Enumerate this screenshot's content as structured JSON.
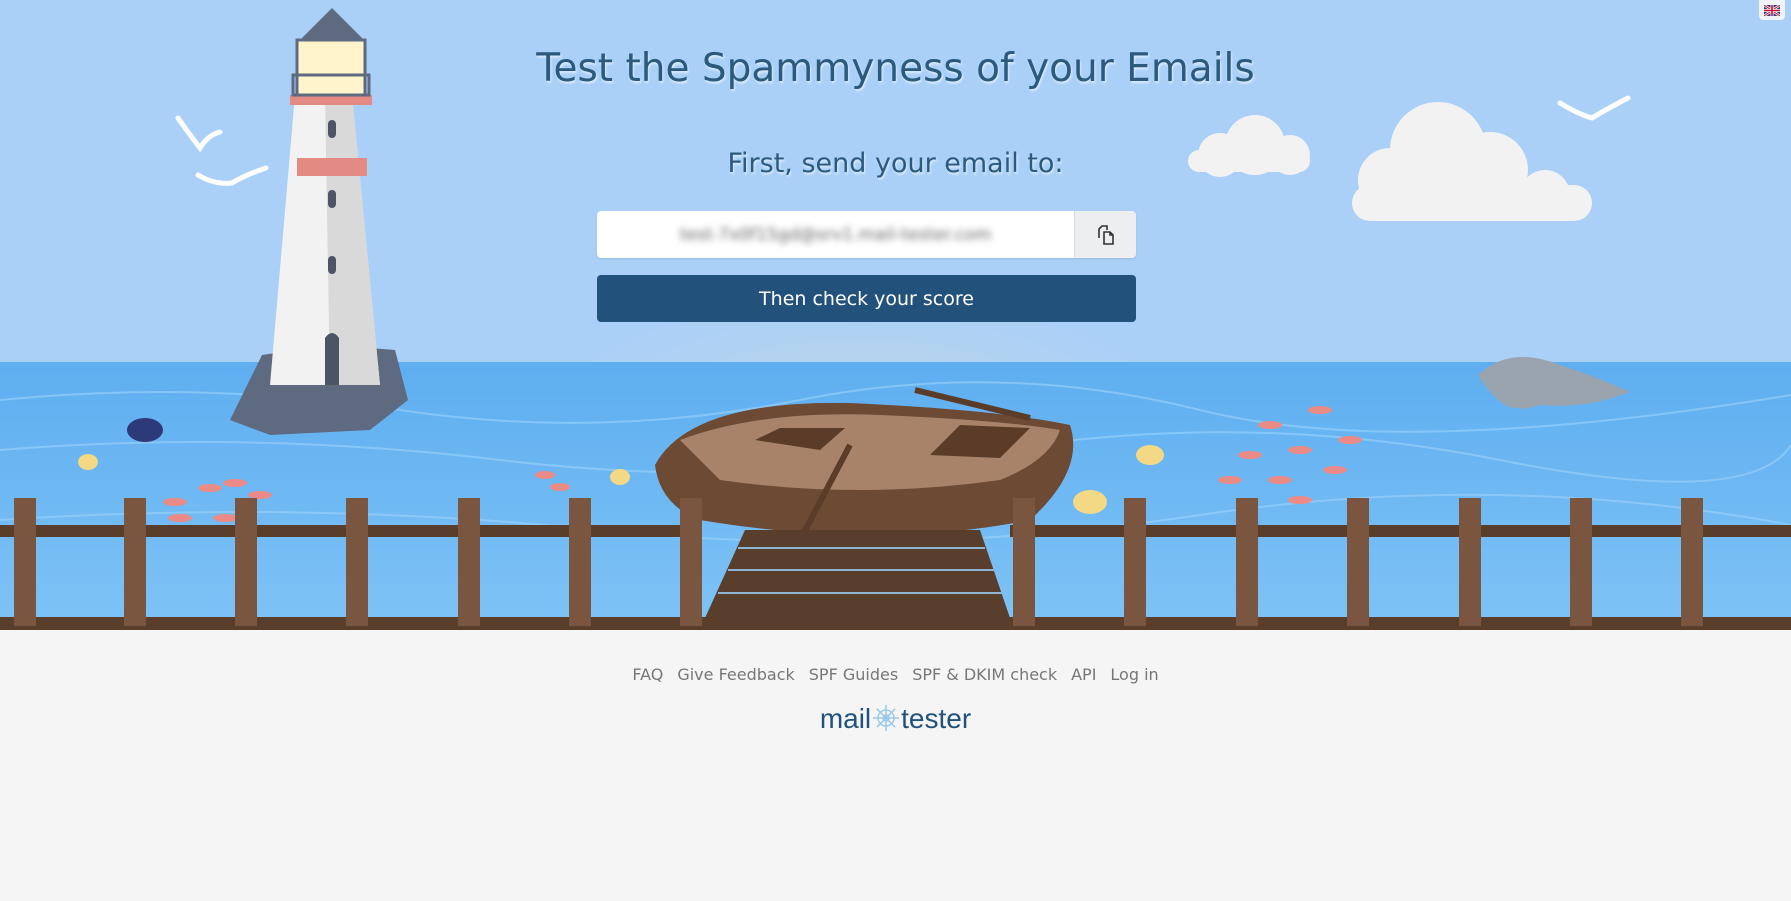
{
  "header": {
    "title": "Test the Spammyness of your Emails",
    "subtitle": "First, send your email to:"
  },
  "email_field": {
    "value": "test-7x0f15gd@srv1.mail-tester.com",
    "copy_icon": "copy-icon"
  },
  "check_button": {
    "label": "Then check your score"
  },
  "language": {
    "icon": "uk-flag-icon"
  },
  "footer": {
    "links": [
      {
        "label": "FAQ"
      },
      {
        "label": "Give Feedback"
      },
      {
        "label": "SPF Guides"
      },
      {
        "label": "SPF & DKIM check"
      },
      {
        "label": "API"
      },
      {
        "label": "Log in"
      }
    ],
    "logo_left": "mail",
    "logo_right": "tester"
  },
  "colors": {
    "primary": "#22527c",
    "title": "#2c5a7d",
    "sky": "#a8d0f7",
    "sea": "#6ab6f2",
    "footer_bg": "#f5f5f5"
  }
}
